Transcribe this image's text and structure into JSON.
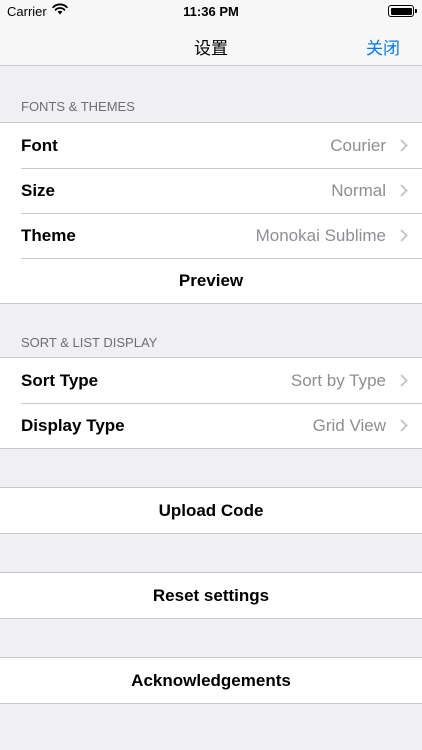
{
  "status_bar": {
    "carrier": "Carrier",
    "time": "11:36 PM"
  },
  "nav": {
    "title": "设置",
    "close_label": "关闭"
  },
  "sections": {
    "fonts_themes": {
      "header": "FONTS & THEMES",
      "font": {
        "label": "Font",
        "value": "Courier"
      },
      "size": {
        "label": "Size",
        "value": "Normal"
      },
      "theme": {
        "label": "Theme",
        "value": "Monokai Sublime"
      },
      "preview": {
        "label": "Preview"
      }
    },
    "sort_list": {
      "header": "SORT & LIST DISPLAY",
      "sort_type": {
        "label": "Sort Type",
        "value": "Sort by Type"
      },
      "display_type": {
        "label": "Display Type",
        "value": "Grid View"
      }
    }
  },
  "actions": {
    "upload": "Upload Code",
    "reset": "Reset settings",
    "acknowledgements": "Acknowledgements"
  },
  "icons": {
    "wifi": "wifi-icon",
    "battery": "battery-icon",
    "chevron": "chevron-right-icon"
  },
  "colors": {
    "accent": "#007aff",
    "background": "#efeff4",
    "secondary_text": "#8e8e93"
  }
}
